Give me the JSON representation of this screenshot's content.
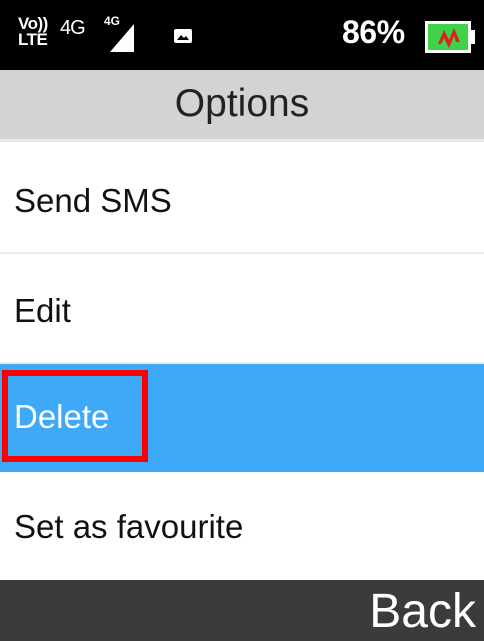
{
  "status_bar": {
    "volte_top": "Vo))",
    "volte_bottom": "LTE",
    "network": "4G",
    "signal_network": "4G",
    "battery_percent": "86%",
    "icons": [
      "volte-icon",
      "signal-icon",
      "gallery-icon",
      "battery-charging-icon"
    ],
    "battery_color": "#3fd34a",
    "charging_bolt_color": "#e02020"
  },
  "header": {
    "title": "Options"
  },
  "menu": {
    "items": [
      {
        "label": "Send SMS"
      },
      {
        "label": "Edit"
      },
      {
        "label": "Delete",
        "selected": true
      },
      {
        "label": "Set as favourite"
      }
    ],
    "selected_color": "#3ea8f9"
  },
  "softkeys": {
    "right": "Back"
  },
  "annotation": {
    "highlight_color": "#ff0000"
  }
}
